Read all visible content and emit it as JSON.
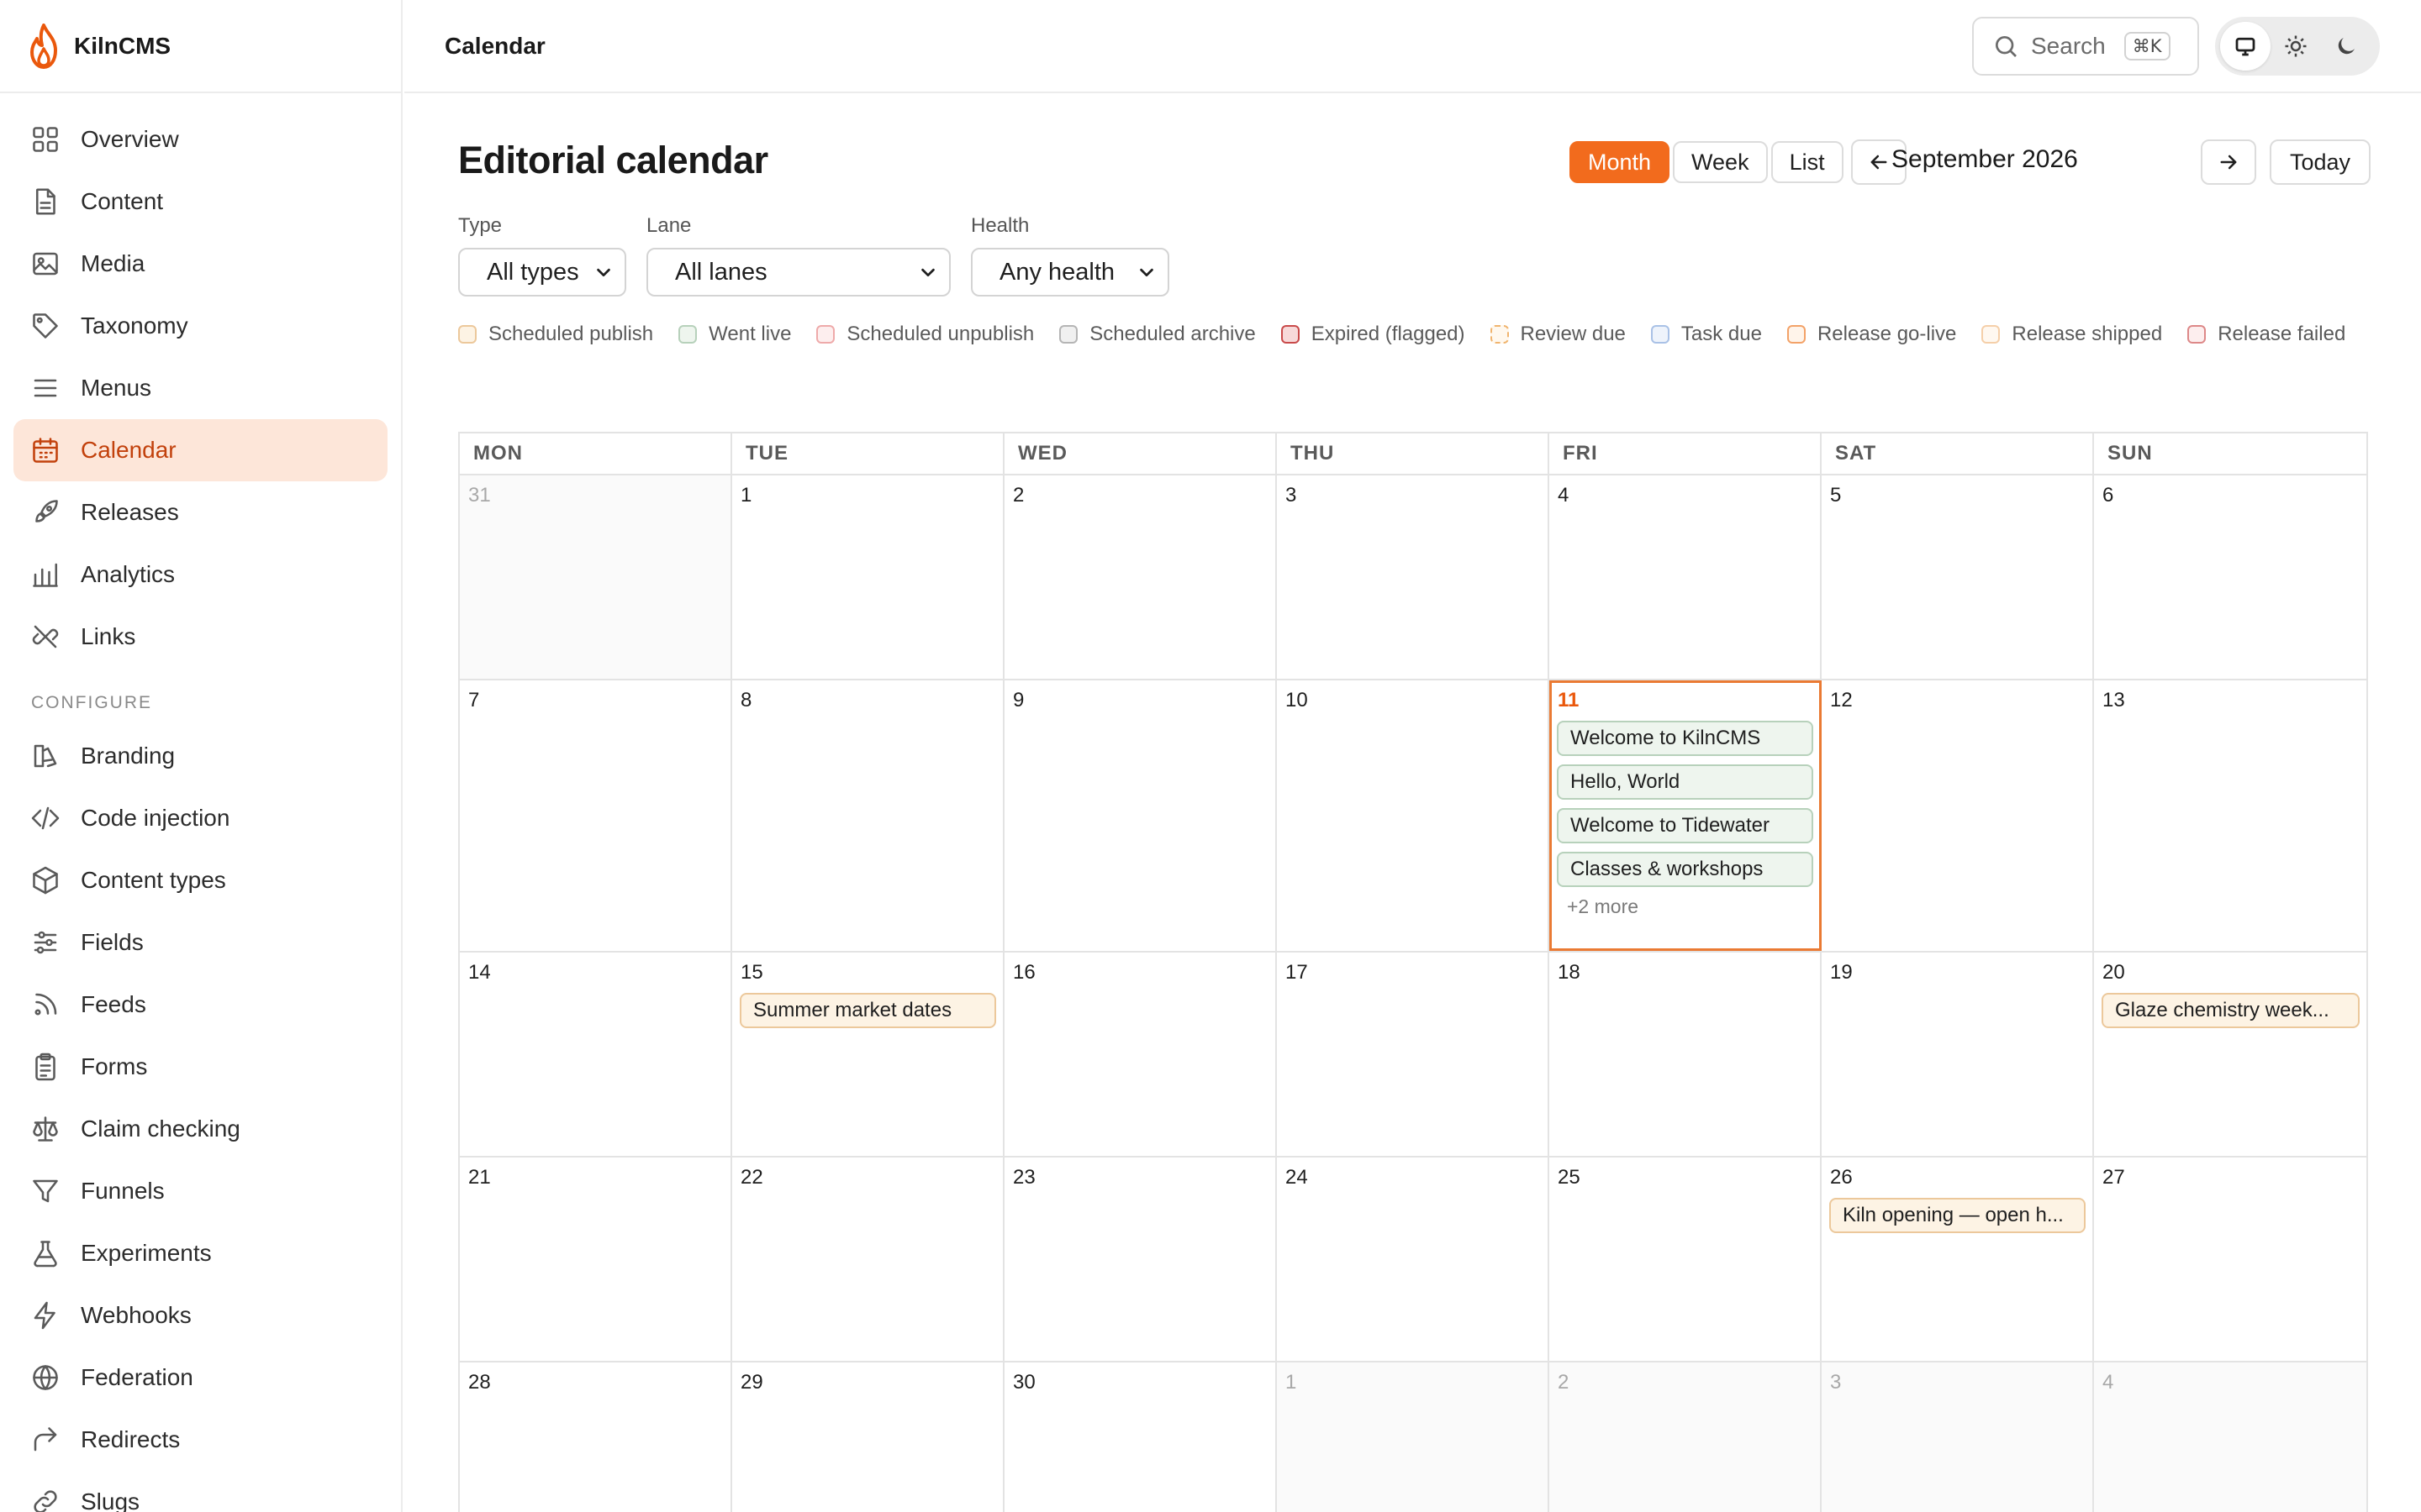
{
  "app": {
    "name": "KilnCMS"
  },
  "colors": {
    "accent": "#f26b1d",
    "active_nav_bg": "#fde6d9",
    "today_outline": "#ea7a33"
  },
  "sidebar": {
    "items": [
      {
        "label": "Overview",
        "icon": "grid-icon"
      },
      {
        "label": "Content",
        "icon": "document-icon"
      },
      {
        "label": "Media",
        "icon": "image-icon"
      },
      {
        "label": "Taxonomy",
        "icon": "tag-icon"
      },
      {
        "label": "Menus",
        "icon": "menu-icon"
      },
      {
        "label": "Calendar",
        "icon": "calendar-icon",
        "active": true
      },
      {
        "label": "Releases",
        "icon": "rocket-icon"
      },
      {
        "label": "Analytics",
        "icon": "bar-chart-icon"
      },
      {
        "label": "Links",
        "icon": "link-broken-icon"
      }
    ],
    "section_label": "CONFIGURE",
    "config_items": [
      {
        "label": "Branding",
        "icon": "palette-icon"
      },
      {
        "label": "Code injection",
        "icon": "code-icon"
      },
      {
        "label": "Content types",
        "icon": "cube-icon"
      },
      {
        "label": "Fields",
        "icon": "sliders-icon"
      },
      {
        "label": "Feeds",
        "icon": "rss-icon"
      },
      {
        "label": "Forms",
        "icon": "clipboard-icon"
      },
      {
        "label": "Claim checking",
        "icon": "scale-icon"
      },
      {
        "label": "Funnels",
        "icon": "funnel-icon"
      },
      {
        "label": "Experiments",
        "icon": "flask-icon"
      },
      {
        "label": "Webhooks",
        "icon": "bolt-icon"
      },
      {
        "label": "Federation",
        "icon": "globe-icon"
      },
      {
        "label": "Redirects",
        "icon": "redirect-icon"
      },
      {
        "label": "Slugs",
        "icon": "link-icon"
      }
    ]
  },
  "header": {
    "title": "Calendar",
    "search_placeholder": "Search",
    "search_shortcut": "⌘K",
    "theme_options": [
      "monitor-icon",
      "sun-icon",
      "moon-icon"
    ]
  },
  "main": {
    "title": "Editorial calendar",
    "views": [
      "Month",
      "Week",
      "List"
    ],
    "active_view": "Month",
    "month_label": "September 2026",
    "today_label": "Today",
    "filters": [
      {
        "label": "Type",
        "value": "All types"
      },
      {
        "label": "Lane",
        "value": "All lanes"
      },
      {
        "label": "Health",
        "value": "Any health"
      }
    ],
    "legend": [
      {
        "label": "Scheduled publish",
        "bg": "#fdf3e4",
        "border": "#ecc89b",
        "style": "solid"
      },
      {
        "label": "Went live",
        "bg": "#eef5ee",
        "border": "#b7d1bb",
        "style": "solid"
      },
      {
        "label": "Scheduled unpublish",
        "bg": "#fdeeee",
        "border": "#eeaaaa",
        "style": "solid"
      },
      {
        "label": "Scheduled archive",
        "bg": "#f0f0f0",
        "border": "#b5b5b5",
        "style": "solid"
      },
      {
        "label": "Expired (flagged)",
        "bg": "#f7d9d9",
        "border": "#c94a4a",
        "style": "solid"
      },
      {
        "label": "Review due",
        "bg": "#fff8ee",
        "border": "#f0b46e",
        "style": "dashed"
      },
      {
        "label": "Task due",
        "bg": "#eef3fb",
        "border": "#a9c1e6",
        "style": "solid"
      },
      {
        "label": "Release go-live",
        "bg": "#fff4ea",
        "border": "#f3a268",
        "style": "solid"
      },
      {
        "label": "Release shipped",
        "bg": "#fff8f0",
        "border": "#f5cfa9",
        "style": "solid"
      },
      {
        "label": "Release failed",
        "bg": "#fdeeee",
        "border": "#dd8888",
        "style": "solid"
      }
    ],
    "weekdays": [
      "MON",
      "TUE",
      "WED",
      "THU",
      "FRI",
      "SAT",
      "SUN"
    ],
    "weeks": [
      [
        {
          "day": "31",
          "outside": true
        },
        {
          "day": "1"
        },
        {
          "day": "2"
        },
        {
          "day": "3"
        },
        {
          "day": "4"
        },
        {
          "day": "5"
        },
        {
          "day": "6"
        }
      ],
      [
        {
          "day": "7"
        },
        {
          "day": "8"
        },
        {
          "day": "9"
        },
        {
          "day": "10"
        },
        {
          "day": "11",
          "today": true,
          "events": [
            {
              "label": "Welcome to KilnCMS",
              "kind": "live"
            },
            {
              "label": "Hello, World",
              "kind": "live"
            },
            {
              "label": "Welcome to Tidewater",
              "kind": "live"
            },
            {
              "label": "Classes & workshops",
              "kind": "live"
            }
          ],
          "more": "+2 more"
        },
        {
          "day": "12"
        },
        {
          "day": "13"
        }
      ],
      [
        {
          "day": "14"
        },
        {
          "day": "15",
          "events": [
            {
              "label": "Summer market dates",
              "kind": "scheduled"
            }
          ]
        },
        {
          "day": "16"
        },
        {
          "day": "17"
        },
        {
          "day": "18"
        },
        {
          "day": "19"
        },
        {
          "day": "20",
          "events": [
            {
              "label": "Glaze chemistry week...",
              "kind": "scheduled"
            }
          ]
        }
      ],
      [
        {
          "day": "21"
        },
        {
          "day": "22"
        },
        {
          "day": "23"
        },
        {
          "day": "24"
        },
        {
          "day": "25"
        },
        {
          "day": "26",
          "events": [
            {
              "label": "Kiln opening — open h...",
              "kind": "scheduled"
            }
          ]
        },
        {
          "day": "27"
        }
      ],
      [
        {
          "day": "28"
        },
        {
          "day": "29"
        },
        {
          "day": "30"
        },
        {
          "day": "1",
          "outside": true
        },
        {
          "day": "2",
          "outside": true
        },
        {
          "day": "3",
          "outside": true
        },
        {
          "day": "4",
          "outside": true
        }
      ]
    ]
  }
}
